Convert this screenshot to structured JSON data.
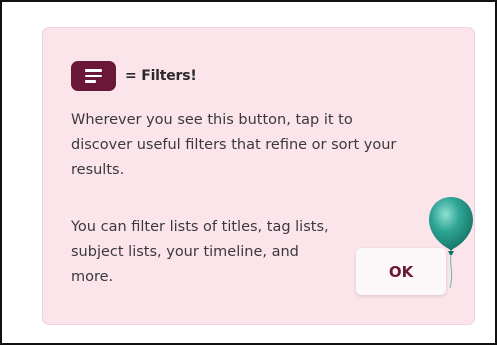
{
  "tip": {
    "heading": "= Filters!",
    "paragraph_1": "Wherever you see this button, tap it to discover useful filters that refine or sort your results.",
    "paragraph_2": "You can filter lists of titles, tag lists, subject lists, your timeline, and more.",
    "ok_label": "OK",
    "icons": {
      "filter_button": "filter-menu-icon",
      "decoration": "balloon-icon"
    }
  },
  "colors": {
    "card_background": "#fbe4ea",
    "accent": "#6b1838",
    "balloon": "#2fa596"
  }
}
